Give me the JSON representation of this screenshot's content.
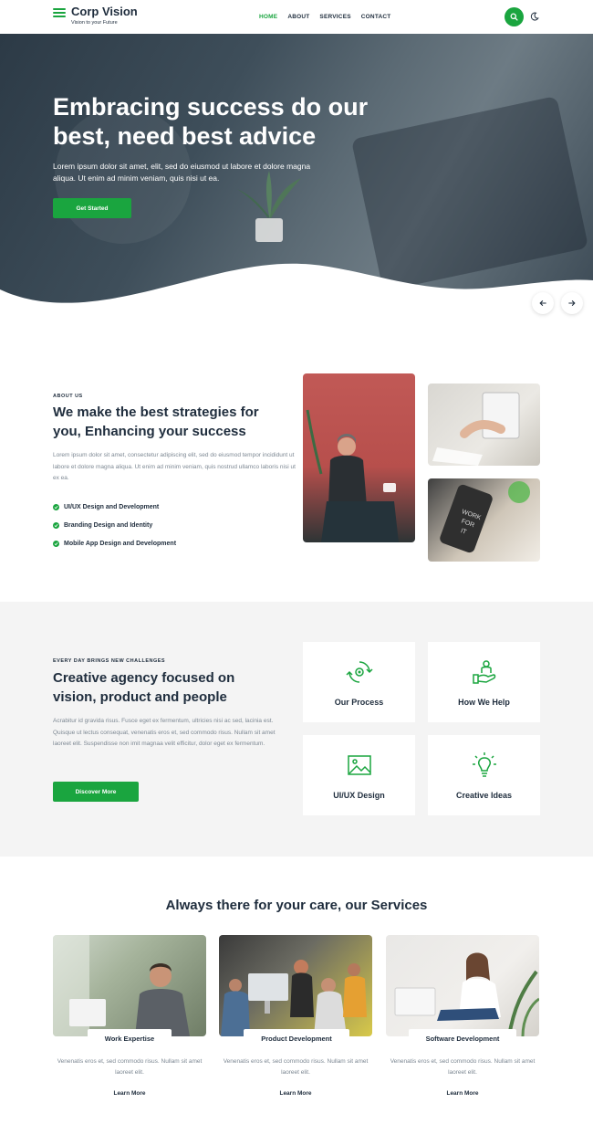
{
  "brand": {
    "name": "Corp Vision",
    "tagline": "Vision to your Future"
  },
  "nav": {
    "items": [
      "HOME",
      "ABOUT",
      "SERVICES",
      "CONTACT"
    ],
    "active": "HOME"
  },
  "hero": {
    "title": "Embracing success do our best, need best advice",
    "description": "Lorem ipsum dolor sit amet, elit, sed do eiusmod ut labore et dolore magna aliqua. Ut enim ad minim veniam, quis nisi ut ea.",
    "cta": "Get Started",
    "prev_icon": "arrow-left-icon",
    "next_icon": "arrow-right-icon"
  },
  "about": {
    "eyebrow": "ABOUT US",
    "title": "We make the best strategies for you, Enhancing your success",
    "text": "Lorem ipsum dolor sit amet, consectetur adipiscing elit, sed do eiusmod tempor incididunt ut labore et dolore magna aliqua. Ut enim ad minim veniam, quis nostrud ullamco laboris nisi ut ex ea.",
    "checklist": [
      "UI/UX Design and Development",
      "Branding Design and Identity",
      "Mobile App Design and Development"
    ]
  },
  "process": {
    "eyebrow": "EVERY DAY BRINGS NEW CHALLENGES",
    "title": "Creative agency focused on vision, product and people",
    "text": "Acrabitur id gravida risus. Fusce eget ex fermentum, ultricies nisi ac sed, lacinia est. Quisque ut lectus consequat, venenatis eros et, sed commodo risus. Nullam sit amet laoreet elit. Suspendisse non imit magnaa velit efficitur, dolor eget ex fermentum.",
    "cta": "Discover More",
    "features": [
      {
        "label": "Our Process",
        "icon": "gear-cycle-icon"
      },
      {
        "label": "How We Help",
        "icon": "helping-hand-icon"
      },
      {
        "label": "UI/UX Design",
        "icon": "image-frame-icon"
      },
      {
        "label": "Creative Ideas",
        "icon": "lightbulb-icon"
      }
    ]
  },
  "services": {
    "title": "Always there for your care, our Services",
    "items": [
      {
        "label": "Work Expertise",
        "desc": "Venenatis eros et, sed commodo risus. Nullam sit amet laoreet elit.",
        "link": "Learn More"
      },
      {
        "label": "Product Development",
        "desc": "Venenatis eros et, sed commodo risus. Nullam sit amet laoreet elit.",
        "link": "Learn More"
      },
      {
        "label": "Software Development",
        "desc": "Venenatis eros et, sed commodo risus. Nullam sit amet laoreet elit.",
        "link": "Learn More"
      }
    ]
  },
  "colors": {
    "accent": "#1aa53f",
    "heading": "#1f2d3d",
    "muted": "#7d8893",
    "section_bg": "#f4f4f4"
  }
}
